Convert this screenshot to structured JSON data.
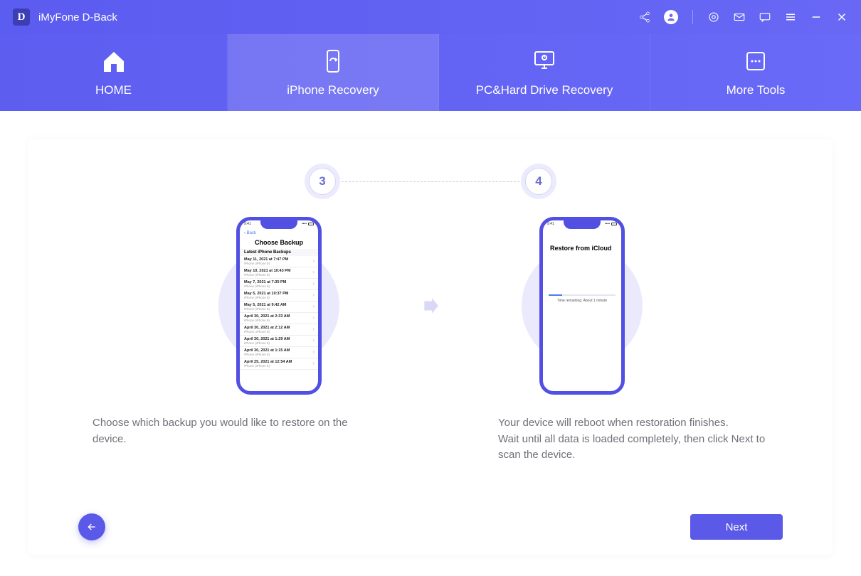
{
  "app": {
    "logo_letter": "D",
    "title": "iMyFone D-Back"
  },
  "tabs": {
    "home": "HOME",
    "iphone": "iPhone Recovery",
    "pc": "PC&Hard Drive Recovery",
    "more": "More Tools"
  },
  "steps": {
    "left_num": "3",
    "right_num": "4"
  },
  "phone3": {
    "back": "Back",
    "title": "Choose Backup",
    "section": "Latest iPhone Backups",
    "rows": [
      {
        "t1": "May 11, 2021 at 7:47 PM",
        "t2": "iPhone (iPhone 8)"
      },
      {
        "t1": "May 10, 2021 at 10:43 PM",
        "t2": "iPhone (iPhone 8)"
      },
      {
        "t1": "May 7, 2021 at 7:35 PM",
        "t2": "iPhone (iPhone 8)"
      },
      {
        "t1": "May 5, 2021 at 10:37 PM",
        "t2": "iPhone (iPhone 8)"
      },
      {
        "t1": "May 5, 2021 at 9:42 AM",
        "t2": "iPhone (iPhone 8)"
      },
      {
        "t1": "April 30, 2021 at 2:33 AM",
        "t2": "iPhone (iPhone 8)"
      },
      {
        "t1": "April 30, 2021 at 2:12 AM",
        "t2": "iPhone (iPhone 8)"
      },
      {
        "t1": "April 30, 2021 at 1:29 AM",
        "t2": "iPhone (iPhone 8)"
      },
      {
        "t1": "April 30, 2021 at 1:15 AM",
        "t2": "iPhone (iPhone 8)"
      },
      {
        "t1": "April 25, 2021 at 12:54 AM",
        "t2": "iPhone (iPhone 8)"
      }
    ]
  },
  "phone4": {
    "title": "Restore from iCloud",
    "time": "Time remaining: About 1 minute"
  },
  "desc": {
    "left": "Choose which backup you would like to restore on the device.",
    "right": "Your device will reboot when restoration finishes.\nWait until all data is loaded completely, then click Next to scan the device."
  },
  "buttons": {
    "next": "Next"
  }
}
